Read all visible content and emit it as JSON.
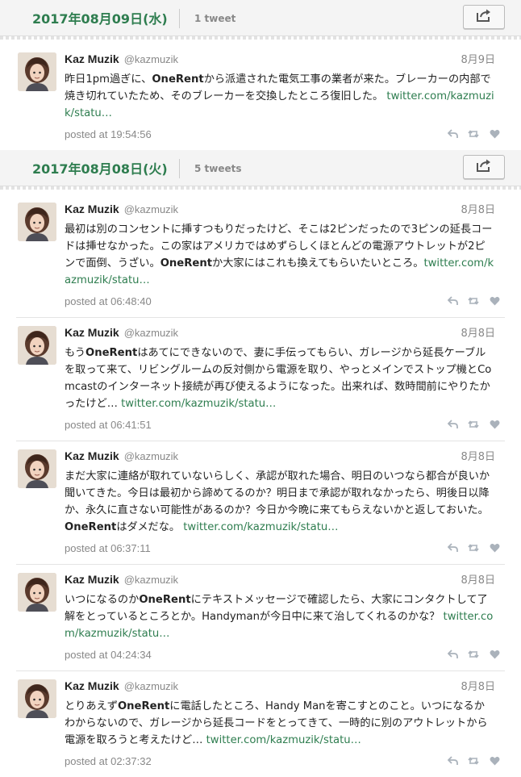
{
  "days": [
    {
      "date": "2017年08月09日(水)",
      "count": "1 tweet",
      "tweets": [
        {
          "author": "Kaz Muzik",
          "handle": "@kazmuzik",
          "date": "8月9日",
          "parts": [
            {
              "t": "昨日1pm過ぎに、"
            },
            {
              "b": "OneRent"
            },
            {
              "t": "から派遣された電気工事の業者が来た。ブレーカーの内部で焼き切れていたため、そのブレーカーを交換したところ復旧した。 "
            },
            {
              "l": "twitter.com/kazmuzik/statu…"
            }
          ],
          "posted": "posted at 19:54:56"
        }
      ]
    },
    {
      "date": "2017年08月08日(火)",
      "count": "5 tweets",
      "tweets": [
        {
          "author": "Kaz Muzik",
          "handle": "@kazmuzik",
          "date": "8月8日",
          "parts": [
            {
              "t": "最初は別のコンセントに挿すつもりだったけど、そこは2ピンだったので3ピンの延長コードは挿せなかった。この家はアメリカではめずらしくほとんどの電源アウトレットが2ピンで面倒、うざい。"
            },
            {
              "b": "OneRent"
            },
            {
              "t": "か大家にはこれも換えてもらいたいところ。"
            },
            {
              "l": "twitter.com/kazmuzik/statu…"
            }
          ],
          "posted": "posted at 06:48:40"
        },
        {
          "author": "Kaz Muzik",
          "handle": "@kazmuzik",
          "date": "8月8日",
          "parts": [
            {
              "t": "もう"
            },
            {
              "b": "OneRent"
            },
            {
              "t": "はあてにできないので、妻に手伝ってもらい、ガレージから延長ケーブルを取って来て、リビングルームの反対側から電源を取り、やっとメインでストップ機とComcastのインターネット接続が再び使えるようになった。出来れば、数時間前にやりたかったけど… "
            },
            {
              "l": "twitter.com/kazmuzik/statu…"
            }
          ],
          "posted": "posted at 06:41:51"
        },
        {
          "author": "Kaz Muzik",
          "handle": "@kazmuzik",
          "date": "8月8日",
          "parts": [
            {
              "t": "まだ大家に連絡が取れていないらしく、承認が取れた場合、明日のいつなら都合が良いか聞いてきた。今日は最初から諦めてるのか？明日まで承認が取れなかったら、明後日以降か、永久に直さない可能性があるのか？今日か今晩に来てもらえないかと返しておいた。"
            },
            {
              "b": "OneRent"
            },
            {
              "t": "はダメだな。 "
            },
            {
              "l": "twitter.com/kazmuzik/statu…"
            }
          ],
          "posted": "posted at 06:37:11"
        },
        {
          "author": "Kaz Muzik",
          "handle": "@kazmuzik",
          "date": "8月8日",
          "parts": [
            {
              "t": "いつになるのか"
            },
            {
              "b": "OneRent"
            },
            {
              "t": "にテキストメッセージで確認したら、大家にコンタクトして了解をとっているところとか。Handymanが今日中に来て治してくれるのかな？ "
            },
            {
              "l": "twitter.com/kazmuzik/statu…"
            }
          ],
          "posted": "posted at 04:24:34"
        },
        {
          "author": "Kaz Muzik",
          "handle": "@kazmuzik",
          "date": "8月8日",
          "parts": [
            {
              "t": "とりあえず"
            },
            {
              "b": "OneRent"
            },
            {
              "t": "に電話したところ、Handy Manを寄こすとのこと。いつになるかわからないので、ガレージから延長コードをとってきて、一時的に別のアウトレットから電源を取ろうと考えたけど… "
            },
            {
              "l": "twitter.com/kazmuzik/statu…"
            }
          ],
          "posted": "posted at 02:37:32"
        }
      ]
    }
  ],
  "icons": {
    "share": "share-icon",
    "reply": "reply-icon",
    "retweet": "retweet-icon",
    "favorite": "heart-icon"
  },
  "colors": {
    "accent": "#2e7d4f",
    "muted": "#888888",
    "header_bg": "#f4f4f4",
    "action_icon": "#aab2bb"
  }
}
